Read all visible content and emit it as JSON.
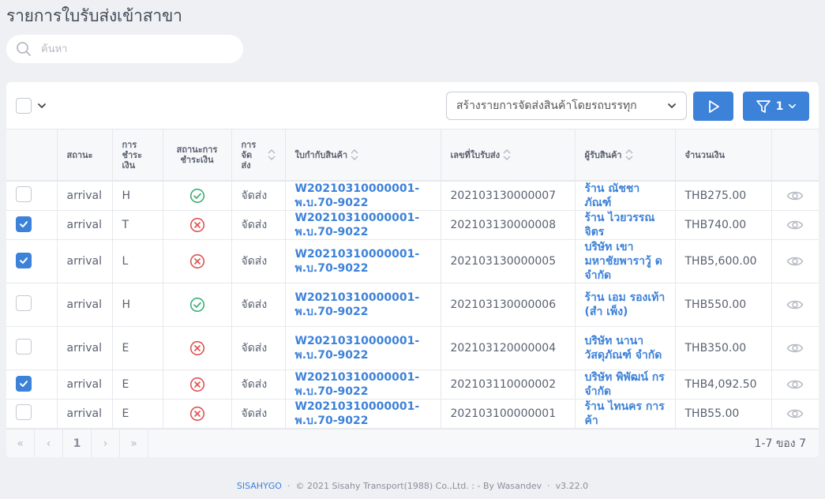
{
  "page": {
    "title": "รายการใบรับส่งเข้าสาขา"
  },
  "search": {
    "placeholder": "ค้นหา",
    "value": ""
  },
  "toolbar": {
    "action_label": "สร้างรายการจัดส่งสินค้าโดยรถบรรทุก",
    "filter_count": "1"
  },
  "table": {
    "headers": {
      "status": "สถานะ",
      "payment": "การ ชำระ เงิน",
      "payment_status": "สถานะการ ชำระเงิน",
      "delivery": "การ จัด ส่ง",
      "shipping_doc": "ใบกำกับสินค้า",
      "receipt_no": "เลขที่ใบรับส่ง",
      "receiver": "ผู้รับสินค้า",
      "amount": "จำนวนเงิน"
    },
    "rows": [
      {
        "checked": false,
        "status": "arrival",
        "payment": "H",
        "paid": true,
        "delivery": "จัดส่ง",
        "doc": "W20210310000001-พ.บ.70-9022",
        "receipt": "202103130000007",
        "receiver": "ร้าน ณัชชา ภัณฑ์",
        "amount": "THB275.00"
      },
      {
        "checked": true,
        "status": "arrival",
        "payment": "T",
        "paid": false,
        "delivery": "จัดส่ง",
        "doc": "W20210310000001-พ.บ.70-9022",
        "receipt": "202103130000008",
        "receiver": "ร้าน ไวยวรรณ จิตร",
        "amount": "THB740.00"
      },
      {
        "checked": true,
        "status": "arrival",
        "payment": "L",
        "paid": false,
        "delivery": "จัดส่ง",
        "doc": "W20210310000001-พ.บ.70-9022",
        "receipt": "202103130000005",
        "receiver": "บริษัท เขา มหาชัยพาราวู้ ด จำกัด",
        "amount": "THB5,600.00"
      },
      {
        "checked": false,
        "status": "arrival",
        "payment": "H",
        "paid": true,
        "delivery": "จัดส่ง",
        "doc": "W20210310000001-พ.บ.70-9022",
        "receipt": "202103130000006",
        "receiver": "ร้าน เอม รองเท้า (สำ เพ็ง)",
        "amount": "THB550.00"
      },
      {
        "checked": false,
        "status": "arrival",
        "payment": "E",
        "paid": false,
        "delivery": "จัดส่ง",
        "doc": "W20210310000001-พ.บ.70-9022",
        "receipt": "202103120000004",
        "receiver": "บริษัท นานา วัสดุภัณฑ์ จำกัด",
        "amount": "THB350.00"
      },
      {
        "checked": true,
        "status": "arrival",
        "payment": "E",
        "paid": false,
        "delivery": "จัดส่ง",
        "doc": "W20210310000001-พ.บ.70-9022",
        "receipt": "202103110000002",
        "receiver": "บริษัท พิพัฒน์ กร จำกัด",
        "amount": "THB4,092.50"
      },
      {
        "checked": false,
        "status": "arrival",
        "payment": "E",
        "paid": false,
        "delivery": "จัดส่ง",
        "doc": "W20210310000001-พ.บ.70-9022",
        "receipt": "202103100000001",
        "receiver": "ร้าน ไทนคร การค้า",
        "amount": "THB55.00"
      }
    ]
  },
  "pagination": {
    "first": "«",
    "prev": "‹",
    "current": "1",
    "next": "›",
    "last": "»",
    "summary": "1-7 ของ 7"
  },
  "footer": {
    "brand": "SISAHYGO",
    "sep1": "·",
    "copyright": "© 2021 Sisahy Transport(1988) Co.,Ltd. : - By Wasandev",
    "sep2": "·",
    "version": "v3.22.0"
  },
  "colors": {
    "accent": "#3d82d9",
    "success": "#3bb071",
    "danger": "#e05252",
    "background": "#eef0f4"
  }
}
